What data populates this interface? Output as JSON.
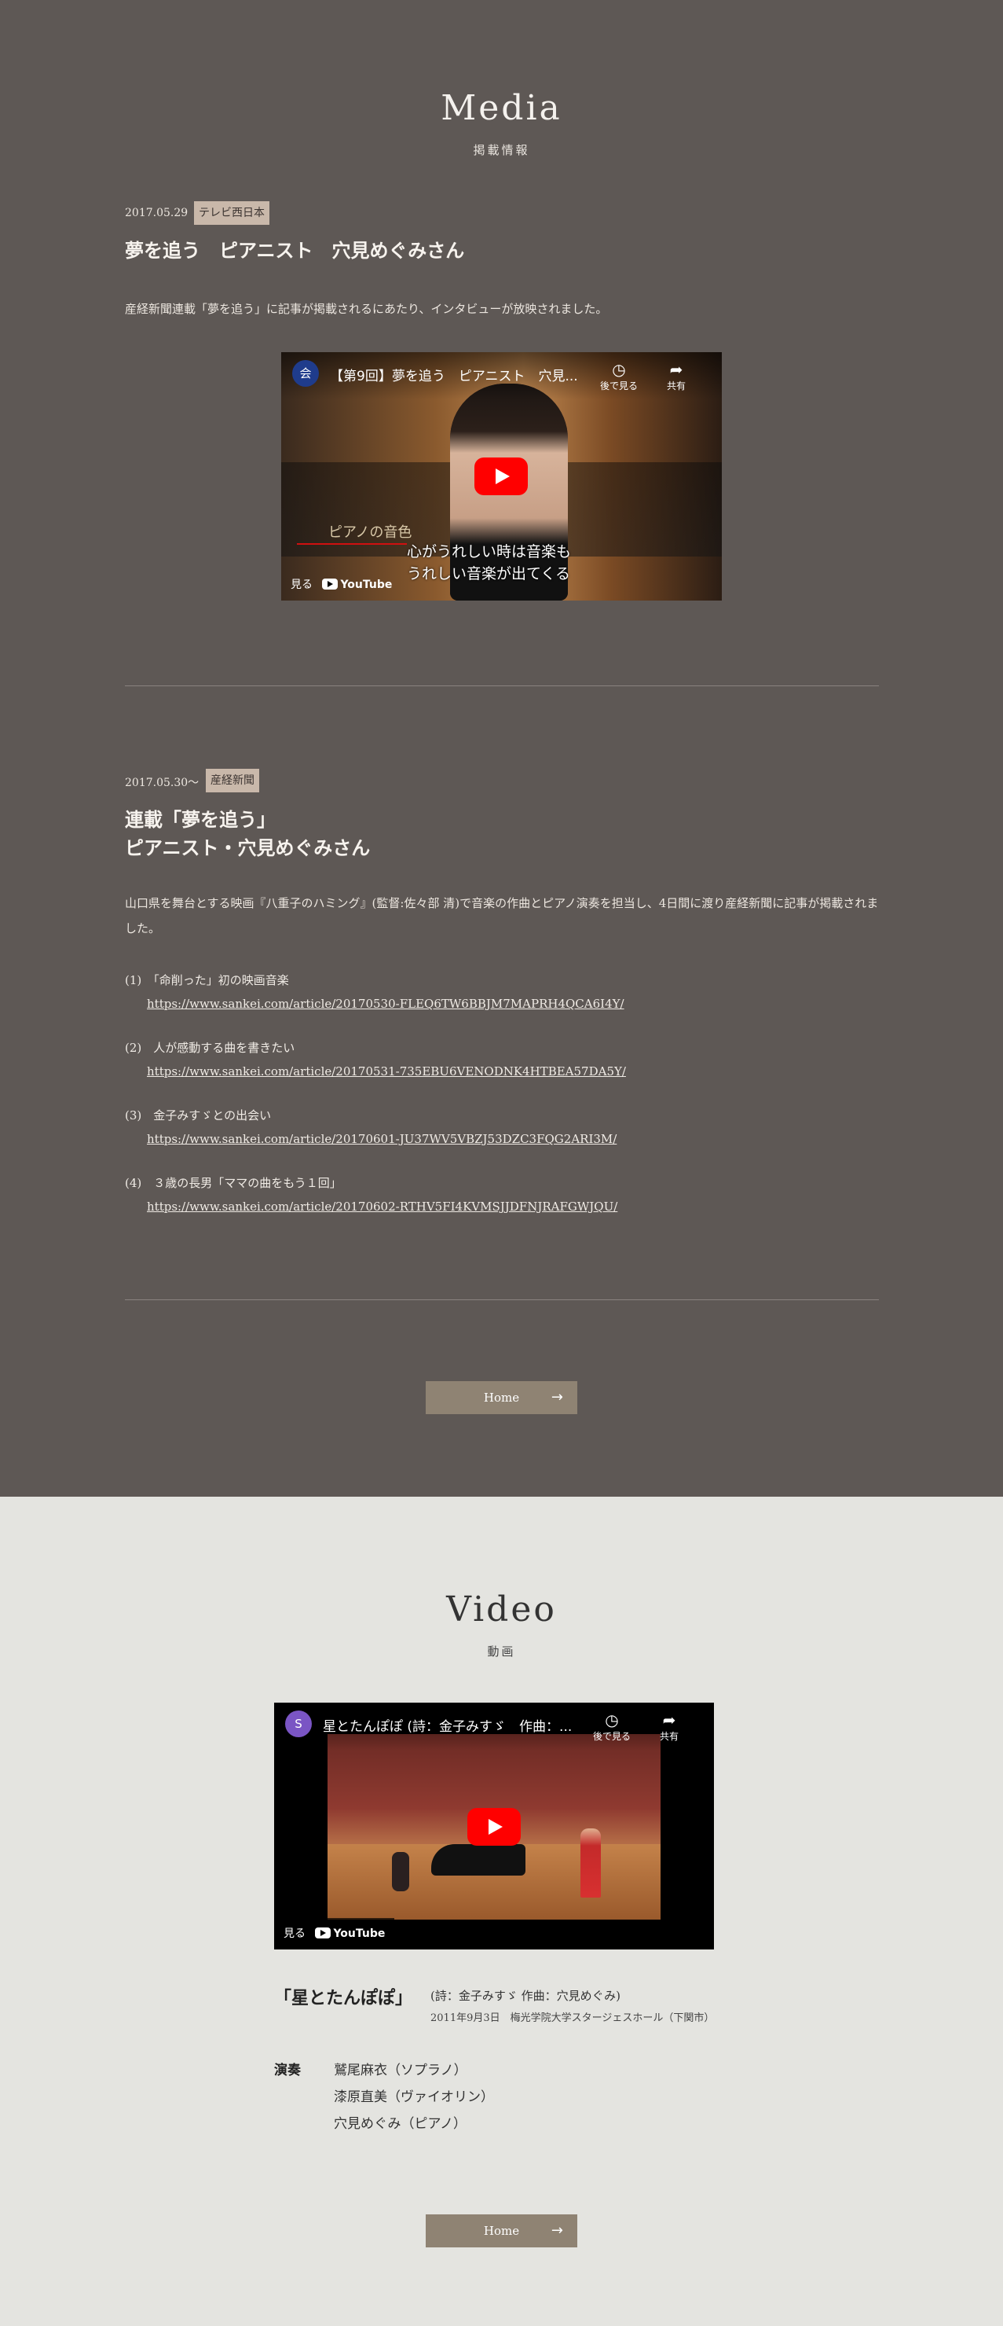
{
  "media": {
    "title": "Media",
    "subtitle": "掲載情報",
    "entries": [
      {
        "date": "2017.05.29",
        "tag": "テレビ西日本",
        "title": "夢を追う　ピアニスト　穴見めぐみさん",
        "text": "産経新聞連載「夢を追う」に記事が掲載されるにあたり、インタビューが放映されました。",
        "video": {
          "channel_logo": "会",
          "title": "【第9回】夢を追う　ピアニスト　穴見...",
          "watch_later": "後で見る",
          "share": "共有",
          "watch_on": "見る",
          "youtube": "YouTube",
          "caption_1": "ピアノの音色",
          "caption_2": "心がうれしい時は音楽も",
          "caption_3": "うれしい音楽が出てくる"
        }
      },
      {
        "date": "2017.05.30〜",
        "tag": "産経新聞",
        "title_line1": "連載「夢を追う」",
        "title_line2": "ピアニスト・穴見めぐみさん",
        "text": "山口県を舞台とする映画『八重子のハミング』(監督:佐々部 清)で音楽の作曲とピアノ演奏を担当し、4日間に渡り産経新聞に記事が掲載されました。",
        "articles": [
          {
            "label": "(1)　「命削った」初の映画音楽",
            "url": "https://www.sankei.com/article/20170530-FLEQ6TW6BBJM7MAPRH4QCA6I4Y/"
          },
          {
            "label": "(2)　人が感動する曲を書きたい",
            "url": "https://www.sankei.com/article/20170531-735EBU6VENODNK4HTBEA57DA5Y/"
          },
          {
            "label": "(3)　金子みすゞとの出会い",
            "url": "https://www.sankei.com/article/20170601-JU37WV5VBZJ53DZC3FQG2ARI3M/"
          },
          {
            "label": "(4)　３歳の長男「ママの曲をもう１回」",
            "url": "https://www.sankei.com/article/20170602-RTHV5FI4KVMSJJDFNJRAFGWJQU/"
          }
        ]
      }
    ],
    "home_button": "Home"
  },
  "video_section": {
    "title": "Video",
    "subtitle": "動画",
    "video": {
      "channel_logo": "S",
      "title": "星とたんぽぽ (詩：金子みすゞ　作曲：...",
      "watch_later": "後で見る",
      "share": "共有",
      "watch_on": "見る",
      "youtube": "YouTube"
    },
    "song_title": "「星とたんぽぽ」",
    "song_credit": "(詩：金子みすゞ 作曲：穴見めぐみ)",
    "song_venue": "2011年9月3日　梅光学院大学スタージェスホール（下関市）",
    "performers_label": "演奏",
    "performers": [
      "鷲尾麻衣（ソプラノ）",
      "漆原直美（ヴァイオリン）",
      "穴見めぐみ（ピアノ）"
    ],
    "home_button": "Home"
  },
  "colors": {
    "media_bg": "#5e5855",
    "video_bg": "#e4e4e0",
    "tag_bg": "#c9b8aa",
    "button_bg": "#8f8373",
    "play_red": "#ff0000"
  }
}
